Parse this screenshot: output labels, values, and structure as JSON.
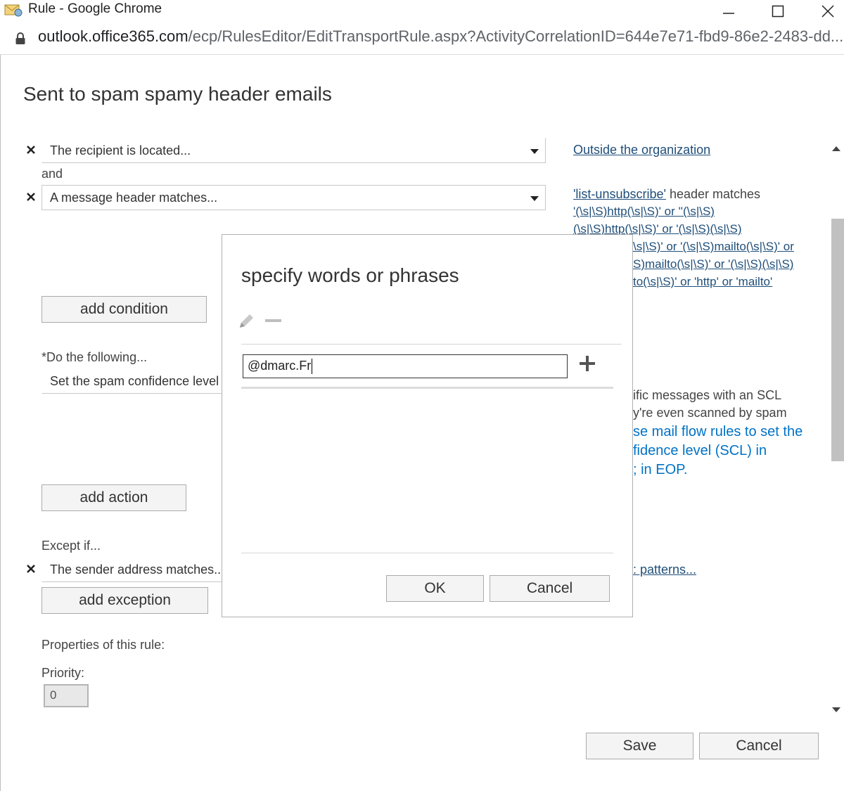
{
  "window": {
    "title": "Rule - Google Chrome",
    "url_host": "outlook.office365.com",
    "url_path": "/ecp/RulesEditor/EditTransportRule.aspx?ActivityCorrelationID=644e7e71-fbd9-86e2-2483-dd..."
  },
  "page": {
    "title": "Sent to spam spamy header emails",
    "conditions": [
      {
        "label": "The recipient is located..."
      },
      {
        "label": "A message header matches..."
      }
    ],
    "and_label": "and",
    "add_condition": "add condition",
    "do_following_label": "*Do the following...",
    "action_label": "Set the spam confidence level",
    "add_action": "add action",
    "except_label": "Except if...",
    "exception_label": "The sender address matches...",
    "add_exception": "add exception",
    "properties_label": "Properties of this rule:",
    "priority_label": "Priority:",
    "priority_value": "0",
    "save": "Save",
    "cancel": "Cancel"
  },
  "right_panel": {
    "recipient_link": "Outside the organization",
    "header_link": "'list-unsubscribe'",
    "header_text": " header matches",
    "header_values": [
      "'(\\s|\\S)http(\\s|\\S)' or ''(\\s|\\S)",
      "(\\s|\\S)http(\\s|\\S)' or '(\\s|\\S)(\\s|\\S)",
      "\\s|\\S)' or '(\\s|\\S)mailto(\\s|\\S)' or",
      "S)mailto(\\s|\\S)' or '(\\s|\\S)(\\s|\\S)",
      "to(\\s|\\S)' or 'http' or 'mailto'"
    ],
    "scl_text_1": "ific messages with an SCL",
    "scl_text_2": "y're even scanned by spam",
    "scl_link_1": "se mail flow rules to set the",
    "scl_link_2": "fidence level (SCL) in",
    "scl_link_3": "; in EOP.",
    "patterns_link": ": patterns..."
  },
  "dialog": {
    "title": "specify words or phrases",
    "input_value": "@dmarc.Fr",
    "ok": "OK",
    "cancel": "Cancel"
  },
  "colors": {
    "link": "#1f4e79",
    "info_link": "#0072c6"
  }
}
